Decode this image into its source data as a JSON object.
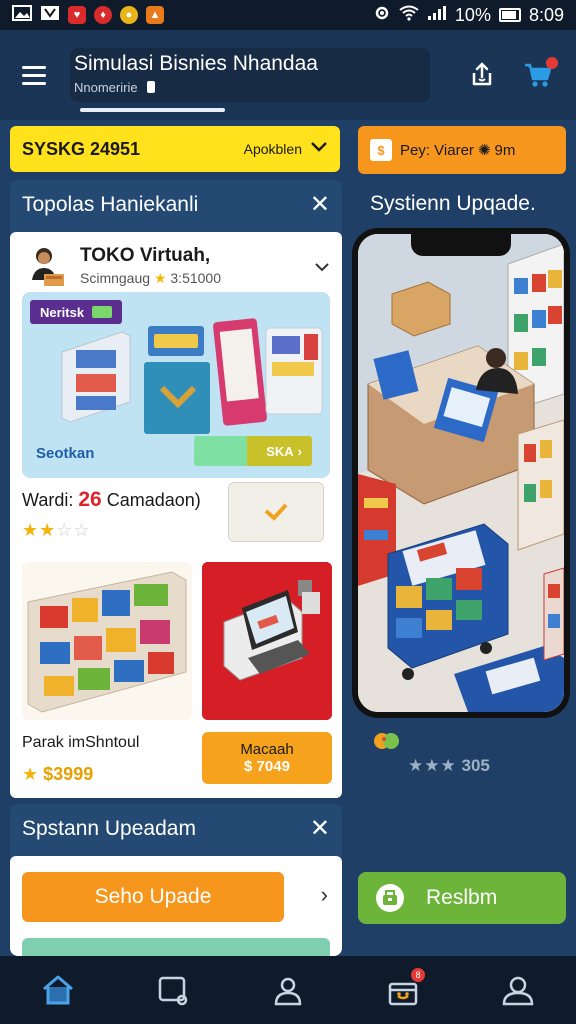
{
  "status_bar": {
    "battery": "10%",
    "time": "8:09",
    "icons": [
      "image-icon",
      "red-app-icon",
      "red-app-icon",
      "yellow-app-icon",
      "orange-app-icon",
      "settings-icon",
      "wifi-icon",
      "signal-icon",
      "battery-icon"
    ]
  },
  "header": {
    "title": "Simulasi Bisnies Nhandaa",
    "subtitle": "Nnomeririe",
    "icons": [
      "menu-icon",
      "share-icon",
      "cart-icon"
    ]
  },
  "promo_bar": {
    "code": "SYSKG 24951",
    "action": "Apokblen"
  },
  "pay_bar": {
    "label": "Pey: Viarer",
    "time": "9m"
  },
  "left_panel": {
    "title": "Topolas Haniekanli",
    "store": {
      "name": "TOKO Virtuah,",
      "subtitle": "Scimngaug",
      "rating_value": "3:51000"
    },
    "promo_card": {
      "tag": "Neritsk",
      "section_label": "Seotkan",
      "button_label": "SKA"
    },
    "price_label": "Wardi:",
    "price_value": "26",
    "price_suffix": "Camadaon)",
    "stars_filled": 2,
    "stars_total": 4,
    "product_name": "Parak imShntoul",
    "product_price": "$3999",
    "buy_button": {
      "label": "Macaah",
      "price": "$ 7049"
    }
  },
  "right_panel": {
    "title": "Systienn Upqade.",
    "rating_text": "305",
    "rating_stars": 3
  },
  "bottom_panel": {
    "title": "Spstann Upeadam",
    "button_label": "Seho Upade"
  },
  "green_button": {
    "label": "Reslbm"
  },
  "bottom_nav": {
    "items": [
      "home-icon",
      "chat-icon",
      "profile-icon",
      "gift-icon",
      "account-icon"
    ],
    "badge": "8"
  },
  "colors": {
    "background": "#1f3f66",
    "header": "#1b3556",
    "yellow": "#ffe21b",
    "orange": "#f6961d",
    "green": "#6cb43a",
    "nav": "#0f1b2b",
    "price_red": "#e0242b"
  }
}
